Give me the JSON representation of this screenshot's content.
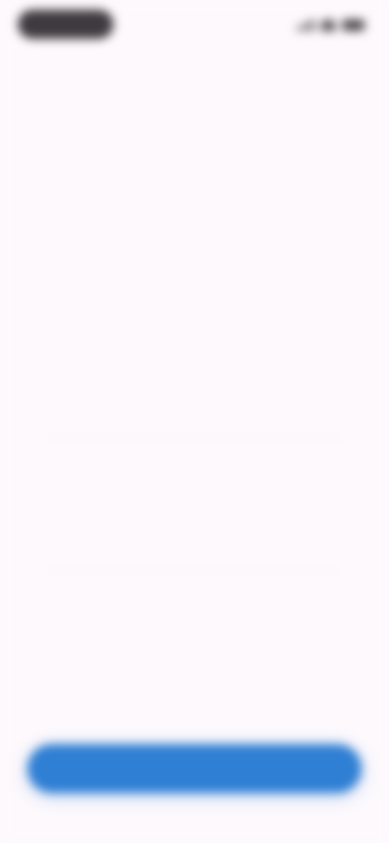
{
  "status_bar": {
    "time": "",
    "icons": [
      "signal-icon",
      "wifi-icon",
      "battery-icon"
    ]
  },
  "header": {
    "title": "",
    "description": "",
    "link": ""
  },
  "options": [
    {
      "label": ""
    },
    {
      "label": ""
    },
    {
      "label": ""
    }
  ],
  "footer": {
    "button_label": ""
  },
  "colors": {
    "background": "#fdf9fd",
    "accent": "#2f7fd4",
    "status_pill": "#3f3a3f"
  }
}
